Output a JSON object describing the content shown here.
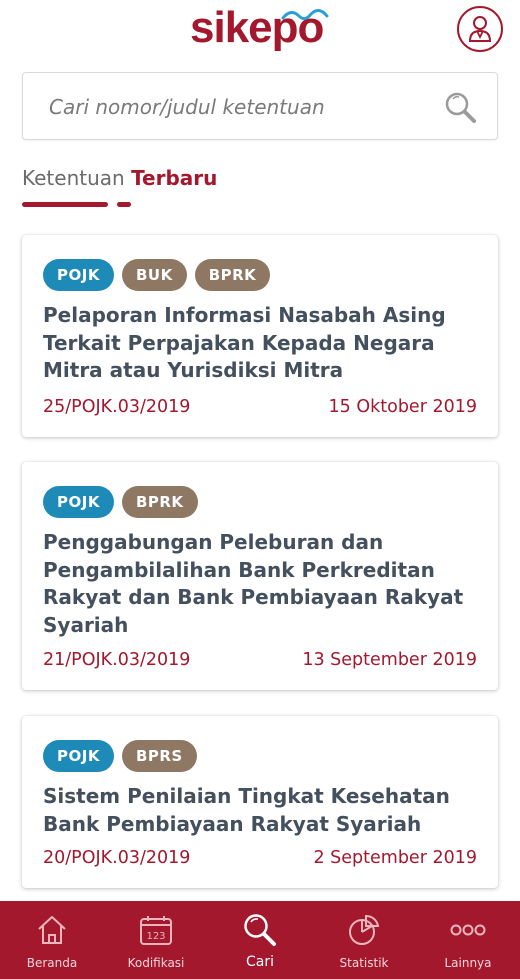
{
  "header": {
    "logo_text": "sike",
    "logo_text_end": "po",
    "profile_icon": "user-icon"
  },
  "search": {
    "placeholder": "Cari nomor/judul ketentuan",
    "icon": "search-icon"
  },
  "section": {
    "title_part1": "Ketentuan",
    "title_part2": "Terbaru"
  },
  "cards": [
    {
      "tags": [
        "POJK",
        "BUK",
        "BPRK"
      ],
      "title": "Pelaporan Informasi Nasabah Asing Terkait Perpajakan Kepada Negara Mitra atau Yurisdiksi Mitra",
      "code": "25/POJK.03/2019",
      "date": "15 Oktober 2019"
    },
    {
      "tags": [
        "POJK",
        "BPRK"
      ],
      "title": "Penggabungan Peleburan dan Pengambilalihan Bank Perkreditan Rakyat dan Bank Pembiayaan Rakyat Syariah",
      "code": "21/POJK.03/2019",
      "date": "13 September 2019"
    },
    {
      "tags": [
        "POJK",
        "BPRS"
      ],
      "title": "Sistem Penilaian Tingkat Kesehatan Bank Pembiayaan Rakyat Syariah",
      "code": "20/POJK.03/2019",
      "date": "2 September 2019"
    }
  ],
  "bottom_nav": {
    "items": [
      {
        "label": "Beranda",
        "icon": "home-icon"
      },
      {
        "label": "Kodifikasi",
        "icon": "calendar-icon"
      },
      {
        "label": "Cari",
        "icon": "search-icon",
        "active": true
      },
      {
        "label": "Statistik",
        "icon": "pie-chart-icon"
      },
      {
        "label": "Lainnya",
        "icon": "more-icon"
      }
    ]
  },
  "colors": {
    "brand": "#a4182d",
    "tag_blue": "#1e8ab8",
    "tag_brown": "#8e7864",
    "text_dark": "#44505e"
  }
}
